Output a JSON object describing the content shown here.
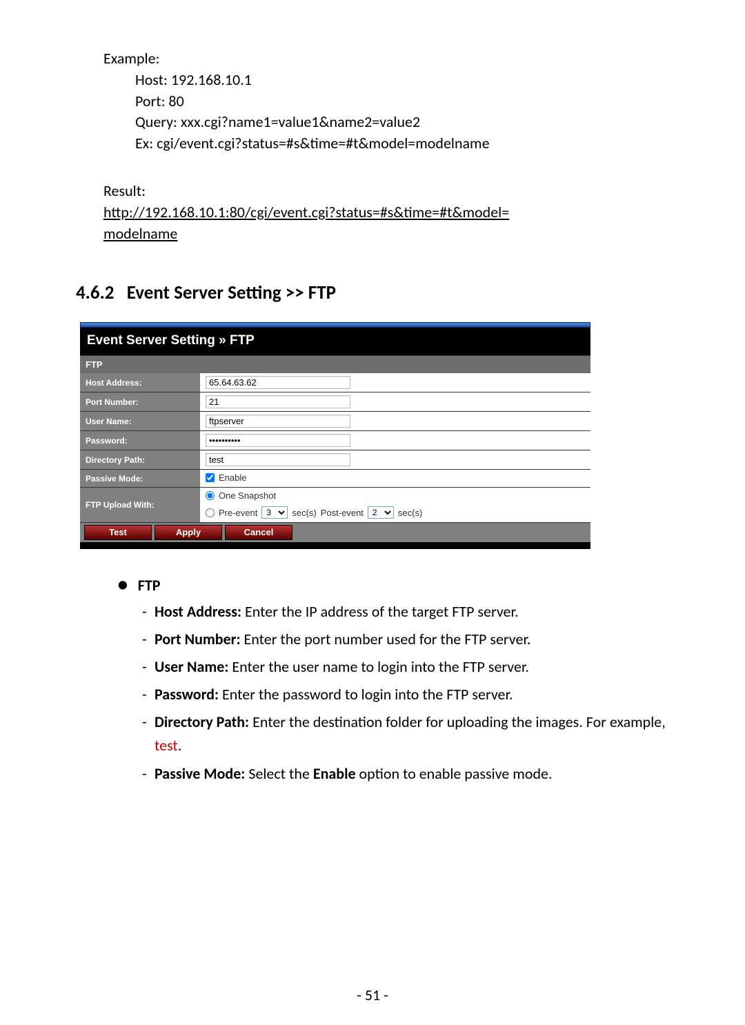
{
  "narrative": {
    "example_label": "Example:",
    "host_line": "Host: 192.168.10.1",
    "port_line": "Port: 80",
    "query_line": "Query: xxx.cgi?name1=value1&name2=value2",
    "ex_line": "Ex: cgi/event.cgi?status=#s&time=#t&model=modelname",
    "result_label": "Result:",
    "result_url_1": "http://192.168.10.1:80/cgi/event.cgi?status=#s&time=#t&model=",
    "result_url_2": "modelname"
  },
  "heading": {
    "number": "4.6.2",
    "title": "Event Server Setting >> FTP"
  },
  "panel": {
    "title": "Event Server Setting » FTP",
    "section": "FTP",
    "labels": {
      "host": "Host Address:",
      "port": "Port Number:",
      "user": "User Name:",
      "pass": "Password:",
      "dir": "Directory Path:",
      "passive": "Passive Mode:",
      "upload": "FTP Upload With:"
    },
    "values": {
      "host": "65.64.63.62",
      "port": "21",
      "user": "ftpserver",
      "pass": "••••••••••",
      "dir": "test",
      "passive_label": "Enable",
      "passive_checked": true,
      "upload_one": "One Snapshot",
      "upload_pre_label": "Pre-event",
      "upload_pre_value": "3",
      "upload_post_label": "Post-event",
      "upload_post_value": "2",
      "upload_secs": "sec(s)"
    },
    "buttons": {
      "test": "Test",
      "apply": "Apply",
      "cancel": "Cancel"
    }
  },
  "descr": {
    "heading": "FTP",
    "items": [
      {
        "label": "Host Address:",
        "text": " Enter the IP address of the target FTP server."
      },
      {
        "label": "Port Number:",
        "text": " Enter the port number used for the FTP server."
      },
      {
        "label": "User Name:",
        "text": " Enter the user name to login into the FTP server."
      },
      {
        "label": "Password:",
        "text": " Enter the password to login into the FTP server."
      },
      {
        "label": "Directory Path:",
        "text": " Enter the destination folder for uploading the images. For example, ",
        "red": "test",
        "tail": "."
      },
      {
        "label": "Passive Mode:",
        "text": " Select the ",
        "bold2": "Enable",
        "tail": " option to enable passive mode."
      }
    ]
  },
  "page_number": "- 51 -"
}
